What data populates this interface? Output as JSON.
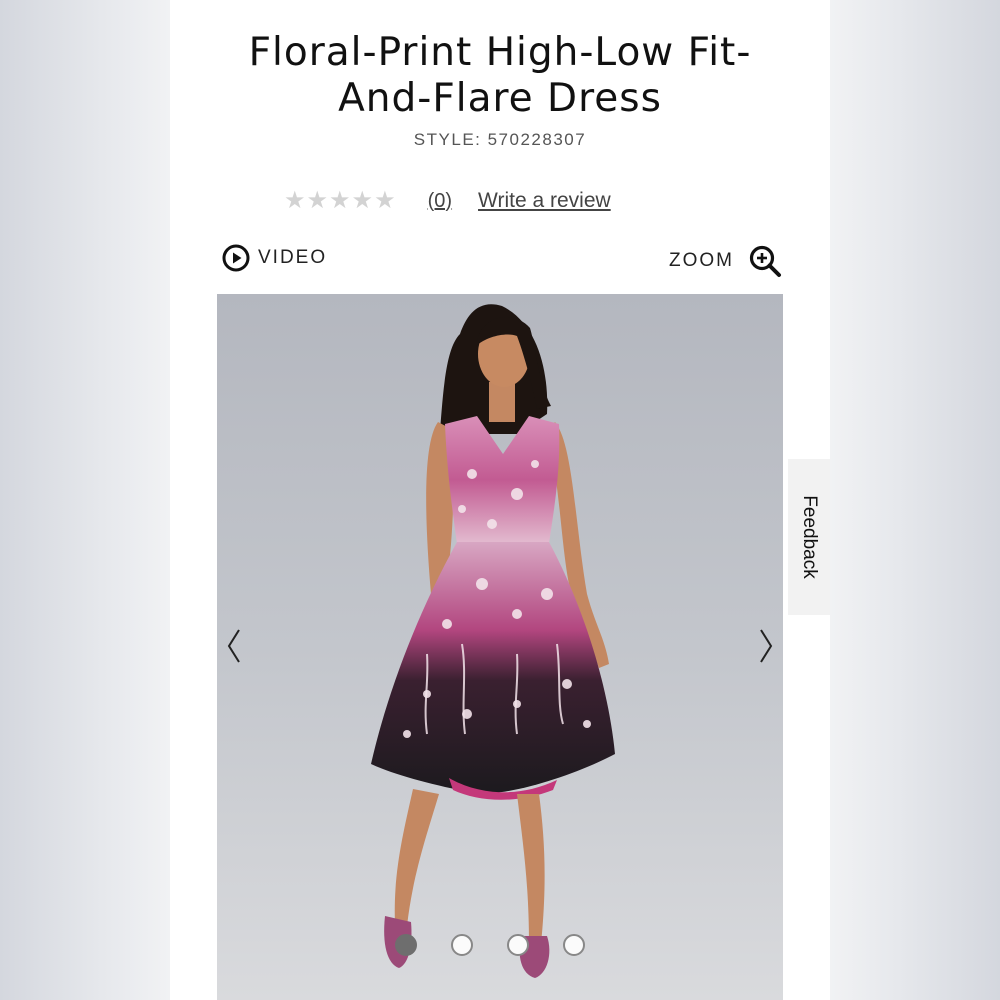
{
  "product": {
    "title_line1": "Floral-Print High-Low Fit-",
    "title_line2": "And-Flare Dress",
    "style_label": "STYLE: 570228307"
  },
  "rating": {
    "stars_filled": 0,
    "stars_total": 5,
    "count_label": "(0)",
    "write_review_label": "Write a review"
  },
  "media": {
    "video_label": "VIDEO",
    "zoom_label": "ZOOM",
    "video_icon": "play-circle-icon",
    "zoom_icon": "zoom-in-icon"
  },
  "gallery": {
    "image_description_icon": "product-photo",
    "prev_icon": "chevron-left-icon",
    "next_icon": "chevron-right-icon",
    "slides_total": 4,
    "active_slide": 1
  },
  "feedback": {
    "label": "Feedback"
  },
  "colors": {
    "dress_dark": "#1c1a1e",
    "dress_pink": "#c4387a",
    "dress_purple": "#6a1f4f",
    "skin": "#c78a62",
    "shoe": "#9c4a78",
    "background_gray": "#c3c6cc"
  }
}
